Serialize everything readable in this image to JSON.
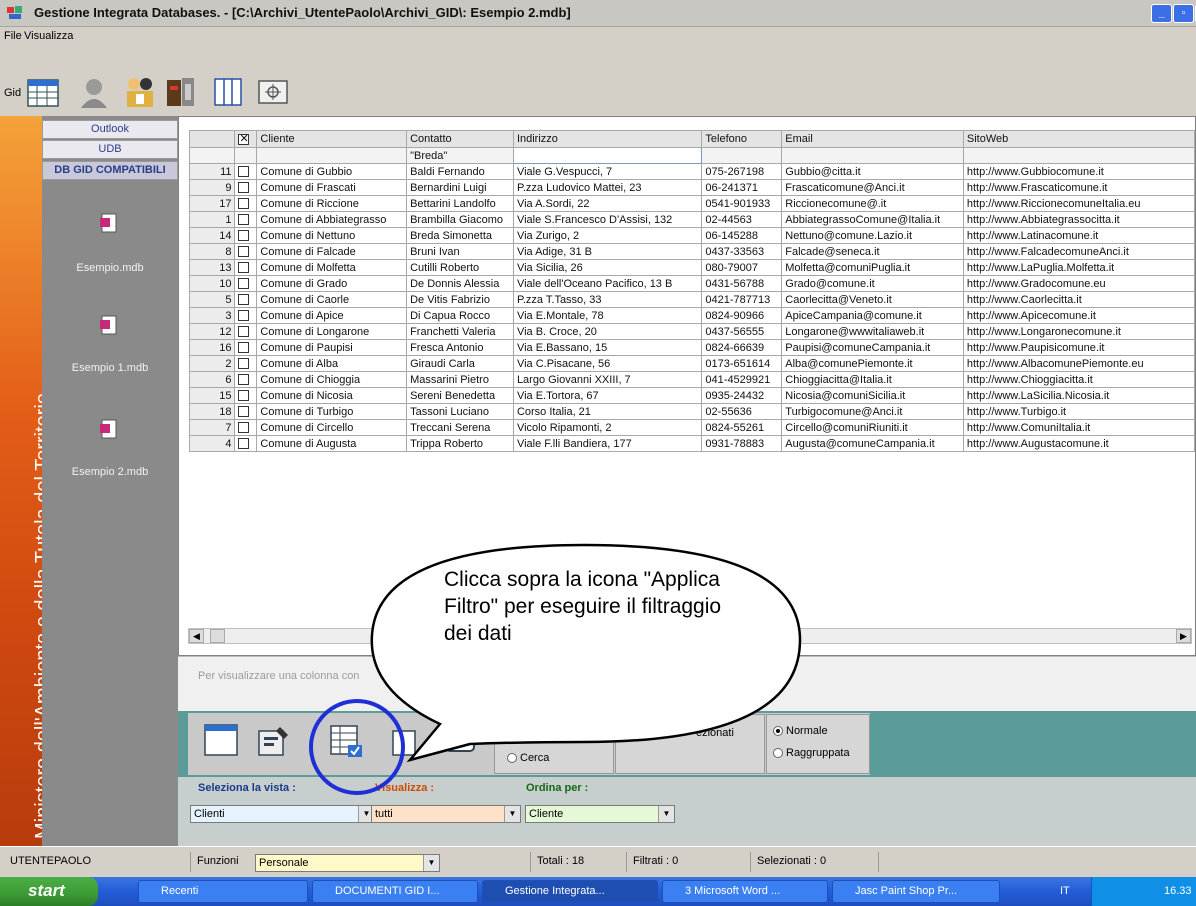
{
  "window": {
    "title": "Gestione Integrata Databases. - [C:\\Archivi_UtentePaolo\\Archivi_GID\\: Esempio 2.mdb]"
  },
  "menu": {
    "file": "File",
    "view": "Visualizza"
  },
  "toolbar": {
    "label": "Gid"
  },
  "side_strip": {
    "text": "Ministero dell'Ambiente e della Tutela del Territorio."
  },
  "nav": {
    "buttons": [
      "Outlook",
      "UDB",
      "DB GID COMPATIBILI"
    ],
    "databases": [
      "Esempio.mdb",
      "Esempio 1.mdb",
      "Esempio 2.mdb"
    ]
  },
  "grid": {
    "columns": [
      "Cliente",
      "Contatto",
      "Indirizzo",
      "Telefono",
      "Email",
      "SitoWeb"
    ],
    "filter": {
      "contatto": "\"Breda\""
    },
    "rows": [
      [
        "11",
        "Comune di Gubbio",
        "Baldi Fernando",
        "Viale G.Vespucci, 7",
        "075-267198",
        "Gubbio@citta.it",
        "http://www.Gubbiocomune.it"
      ],
      [
        "9",
        "Comune di Frascati",
        "Bernardini Luigi",
        "P.zza Ludovico Mattei, 23",
        "06-241371",
        "Frascaticomune@Anci.it",
        "http://www.Frascaticomune.it"
      ],
      [
        "17",
        "Comune di Riccione",
        "Bettarini Landolfo",
        "Via A.Sordi, 22",
        "0541-901933",
        "Riccionecomune@.it",
        "http://www.RiccionecomuneItalia.eu"
      ],
      [
        "1",
        "Comune di Abbiategrasso",
        "Brambilla Giacomo",
        "Viale S.Francesco D'Assisi, 132",
        "02-44563",
        "AbbiategrassoComune@Italia.it",
        "http://www.Abbiategrassocitta.it"
      ],
      [
        "14",
        "Comune di Nettuno",
        "Breda Simonetta",
        "Via Zurigo, 2",
        "06-145288",
        "Nettuno@comune.Lazio.it",
        "http://www.Latinacomune.it"
      ],
      [
        "8",
        "Comune di Falcade",
        "Bruni Ivan",
        "Via Adige, 31 B",
        "0437-33563",
        "Falcade@seneca.it",
        "http://www.FalcadecomuneAnci.it"
      ],
      [
        "13",
        "Comune di Molfetta",
        "Cutilli Roberto",
        "Via Sicilia, 26",
        "080-79007",
        "Molfetta@comuniPuglia.it",
        "http://www.LaPuglia.Molfetta.it"
      ],
      [
        "10",
        "Comune di Grado",
        "De Donnis Alessia",
        "Viale dell'Oceano Pacifico, 13 B",
        "0431-56788",
        "Grado@comune.it",
        "http://www.Gradocomune.eu"
      ],
      [
        "5",
        "Comune di Caorle",
        "De Vitis Fabrizio",
        "P.zza T.Tasso, 33",
        "0421-787713",
        "Caorlecitta@Veneto.it",
        "http://www.Caorlecitta.it"
      ],
      [
        "3",
        "Comune di Apice",
        "Di Capua Rocco",
        "Via E.Montale, 78",
        "0824-90966",
        "ApiceCampania@comune.it",
        "http://www.Apicecomune.it"
      ],
      [
        "12",
        "Comune di Longarone",
        "Franchetti Valeria",
        "Via B. Croce, 20",
        "0437-56555",
        "Longarone@wwwitaliaweb.it",
        "http://www.Longaronecomune.it"
      ],
      [
        "16",
        "Comune di Paupisi",
        "Fresca Antonio",
        "Via E.Bassano, 15",
        "0824-66639",
        "Paupisi@comuneCampania.it",
        "http://www.Paupisicomune.it"
      ],
      [
        "2",
        "Comune di Alba",
        "Giraudi Carla",
        "Via C.Pisacane, 56",
        "0173-651614",
        "Alba@comunePiemonte.it",
        "http://www.AlbacomunePiemonte.eu"
      ],
      [
        "6",
        "Comune di Chioggia",
        "Massarini Pietro",
        "Largo Giovanni XXIII, 7",
        "041-4529921",
        "Chioggiacitta@Italia.it",
        "http://www.Chioggiacitta.it"
      ],
      [
        "15",
        "Comune di Nicosia",
        "Sereni Benedetta",
        "Via E.Tortora, 67",
        "0935-24432",
        "Nicosia@comuniSicilia.it",
        "http://www.LaSicilia.Nicosia.it"
      ],
      [
        "18",
        "Comune di Turbigo",
        "Tassoni Luciano",
        "Corso Italia, 21",
        "02-55636",
        "Turbigocomune@Anci.it",
        "http://www.Turbigo.it"
      ],
      [
        "7",
        "Comune di Circello",
        "Treccani Serena",
        "Vicolo Ripamonti, 2",
        "0824-55261",
        "Circello@comuniRiuniti.it",
        "http://www.ComuniItalia.it"
      ],
      [
        "4",
        "Comune di Augusta",
        "Trippa Roberto",
        "Viale F.lli Bandiera, 177",
        "0931-78883",
        "Augusta@comuneCampania.it",
        "http://www.Augustacomune.it"
      ]
    ]
  },
  "info": {
    "hint": "Per visualizzare una colonna con"
  },
  "callout": {
    "text": "Clicca sopra la icona \"Applica Filtro\" per eseguire il filtraggio dei dati"
  },
  "actions": {
    "search_label": "Cerca",
    "selected_label": "ezionati",
    "normal_label": "Normale",
    "grouped_label": "Raggruppata"
  },
  "selectors": {
    "view_label": "Seleziona la vista :",
    "view_value": "Clienti",
    "show_label": "Visualizza :",
    "show_value": "tutti",
    "order_label": "Ordina per :",
    "order_value": "Cliente"
  },
  "status": {
    "user": "UTENTEPAOLO",
    "functions_label": "Funzioni",
    "functions_value": "Personale",
    "total": "Totali : 18",
    "filtered": "Filtrati : 0",
    "selected": "Selezionati : 0"
  },
  "taskbar": {
    "start": "start",
    "items": [
      "Recenti",
      "DOCUMENTI GID I...",
      "Gestione Integrata...",
      "3 Microsoft Word ...",
      "Jasc Paint Shop Pr..."
    ],
    "lang": "IT",
    "clock": "16.33"
  },
  "colors": {
    "accent_orange": "#e35e18",
    "teal": "#5b9b98",
    "callout_circle": "#1f2fd6"
  }
}
